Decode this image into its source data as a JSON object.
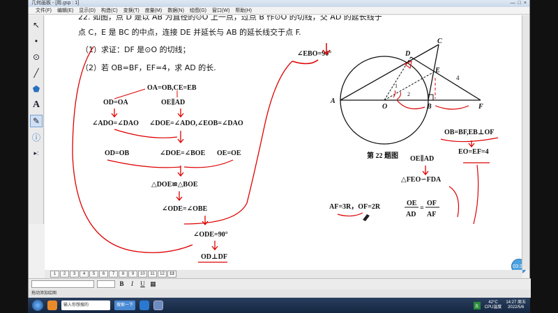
{
  "window": {
    "title": "几何画板 - [用.gsp : 1]"
  },
  "menu": [
    "文件(F)",
    "编辑(E)",
    "显示(D)",
    "构造(C)",
    "变换(T)",
    "度量(M)",
    "数据(N)",
    "绘图(G)",
    "窗口(W)",
    "帮助(H)"
  ],
  "toolbox": {
    "tools": [
      {
        "name": "arrow-select-tool-icon",
        "glyph": "↖"
      },
      {
        "name": "point-tool-icon",
        "glyph": "•"
      },
      {
        "name": "compass-tool-icon",
        "glyph": "⊙"
      },
      {
        "name": "straightedge-tool-icon",
        "glyph": "╱"
      },
      {
        "name": "polygon-tool-icon",
        "glyph": "⬟"
      },
      {
        "name": "text-tool-icon",
        "glyph": "A"
      },
      {
        "name": "marker-tool-icon",
        "glyph": "✎"
      },
      {
        "name": "information-tool-icon",
        "glyph": "ⓘ"
      },
      {
        "name": "custom-tool-icon",
        "glyph": "▸:"
      }
    ]
  },
  "problem": {
    "line1": "22. 如图，点 D 是以 AB 为直径的⊙O 上一点，过点 B 作⊙O 的切线，交 AD 的延长线于",
    "line2": "点 C，E 是 BC 的中点，连接 DE 并延长与 AB 的延长线交于点 F.",
    "q1": "（1）求证：DF 是⊙O 的切线；",
    "q2": "（2）若 OB=BF，EF=4，求 AD 的长."
  },
  "notes": {
    "ebo": "∠EBO=90°",
    "oa_ob_ce_eb": "OA=OB,CE=EB",
    "od_oa": "OD=OA",
    "oe_par_ad": "OE∥AD",
    "ado_dao": "∠ADO=∠DAO",
    "doe_ado_eob_dao": "∠DOE=∠ADO,∠EOB=∠DAO",
    "od_ob": "OD=OB",
    "doe_boe": "∠DOE=∠BOE",
    "oe_oe": "OE=OE",
    "tri_doe_boe": "△DOE≌△BOE",
    "ode_obe": "∠ODE=∠OBE",
    "ode_90": "∠ODE=90°",
    "od_perp_df": "OD⊥DF",
    "ob_bf_eb_perp_of": "OB=BF,EB⊥OF",
    "eo_ef_4": "EO=EF=4",
    "oe_par_ad_2": "OE∥AD",
    "feo_fda": "△FEO∽FDA",
    "af_of": "AF=3R，OF=2R",
    "frac_oe": "OE",
    "frac_ad": "AD",
    "frac_eq": "=",
    "frac_of": "OF",
    "frac_af": "AF"
  },
  "figure": {
    "caption": "第 22 题图",
    "labels": {
      "A": "A",
      "B": "B",
      "C": "C",
      "D": "D",
      "E": "E",
      "F": "F",
      "O": "O",
      "n1": "1",
      "n2": "2",
      "four": "4"
    }
  },
  "pagetabs": [
    "1",
    "2",
    "3",
    "4",
    "5",
    "6",
    "7",
    "8",
    "9",
    "10",
    "11",
    "12",
    "13"
  ],
  "active_tab": "13",
  "formatbar": {
    "bold": "B",
    "italic": "I",
    "underline": "U"
  },
  "status": "拖动添加绘图",
  "timer": "03:32",
  "taskbar": {
    "search_placeholder": "输入你想搜的",
    "search_button": "搜索一下",
    "temp": "42°C",
    "cpu": "CPU温度",
    "time": "14:27 周五",
    "date": "2022/5/6",
    "ime": "五"
  }
}
